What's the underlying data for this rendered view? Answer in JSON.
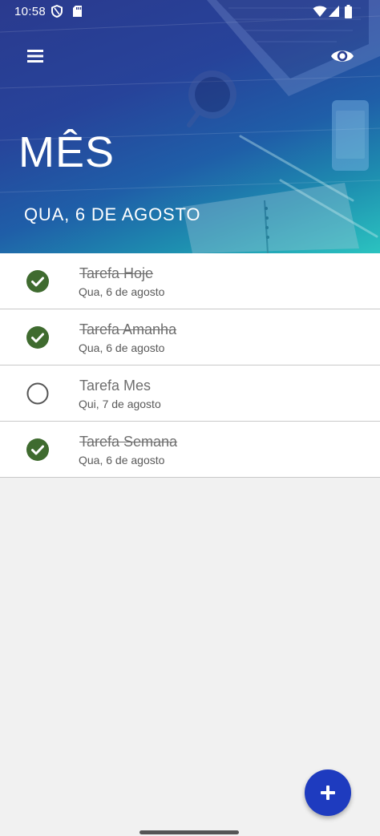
{
  "status_bar": {
    "time": "10:58",
    "icons": [
      "shield-icon",
      "sd-card-icon",
      "wifi-icon",
      "signal-icon",
      "battery-icon"
    ]
  },
  "header": {
    "title": "MÊS",
    "date": "QUA, 6 DE AGOSTO",
    "menu_icon": "hamburger-menu-icon",
    "visibility_icon": "eye-icon"
  },
  "tasks": [
    {
      "title": "Tarefa Hoje",
      "date": "Qua, 6 de agosto",
      "completed": true
    },
    {
      "title": "Tarefa Amanha",
      "date": "Qua, 6 de agosto",
      "completed": true
    },
    {
      "title": "Tarefa Mes",
      "date": "Qui, 7 de agosto",
      "completed": false
    },
    {
      "title": "Tarefa Semana",
      "date": "Qua, 6 de agosto",
      "completed": true
    }
  ],
  "fab": {
    "icon": "plus-icon"
  },
  "colors": {
    "header_start": "#2a3a8e",
    "header_end": "#2bc3c0",
    "check_green": "#3f6b2f",
    "fab_blue": "#1e3bbf",
    "background": "#f1f1f1"
  }
}
